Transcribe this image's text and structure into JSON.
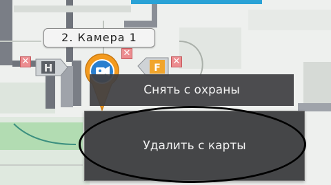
{
  "map": {
    "camera_label": "2. Камера 1",
    "delete_mark": "✕"
  },
  "context_menu": {
    "disarm_label": "Снять с охраны",
    "remove_label": "Удалить с карты"
  },
  "colors": {
    "menu_bg": "#3f3f43",
    "camera_pin": "#f39a1e",
    "camera_center": "#1e78c8",
    "delete_marker": "#ec8d90",
    "grass": "#a6d8a6"
  }
}
